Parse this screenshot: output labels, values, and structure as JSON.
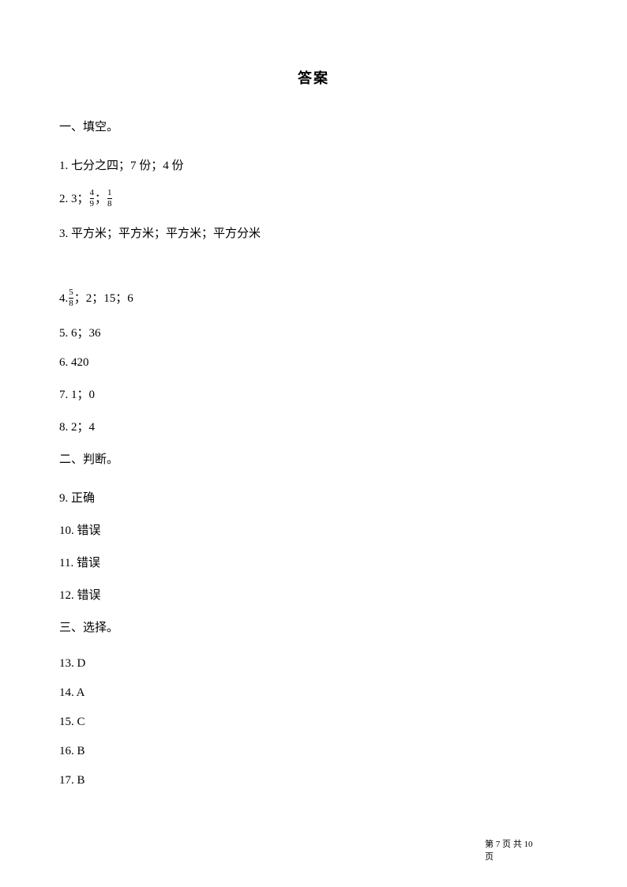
{
  "title": "答案",
  "sections": {
    "s1": "一、填空。",
    "s2": "二、判断。",
    "s3": "三、选择。"
  },
  "answers": {
    "a1": "1. 七分之四；7 份；4 份",
    "a2_prefix": "2. 3；",
    "a2_frac1_num": "4",
    "a2_frac1_den": "9",
    "a2_sep": "；",
    "a2_frac2_num": "1",
    "a2_frac2_den": "8",
    "a3": "3. 平方米；平方米；平方米；平方分米",
    "a4_prefix": "4. ",
    "a4_frac_num": "5",
    "a4_frac_den": "8",
    "a4_suffix": "；2；15；6",
    "a5": "5. 6；36",
    "a6": "6. 420",
    "a7": "7. 1；0",
    "a8": "8. 2；4",
    "a9": "9. 正确",
    "a10": "10. 错误",
    "a11": "11. 错误",
    "a12": "12. 错误",
    "a13": "13. D",
    "a14": "14. A",
    "a15": "15. C",
    "a16": "16. B",
    "a17": "17. B"
  },
  "footer": {
    "line1": "第 7 页 共 10",
    "line2": "页"
  }
}
